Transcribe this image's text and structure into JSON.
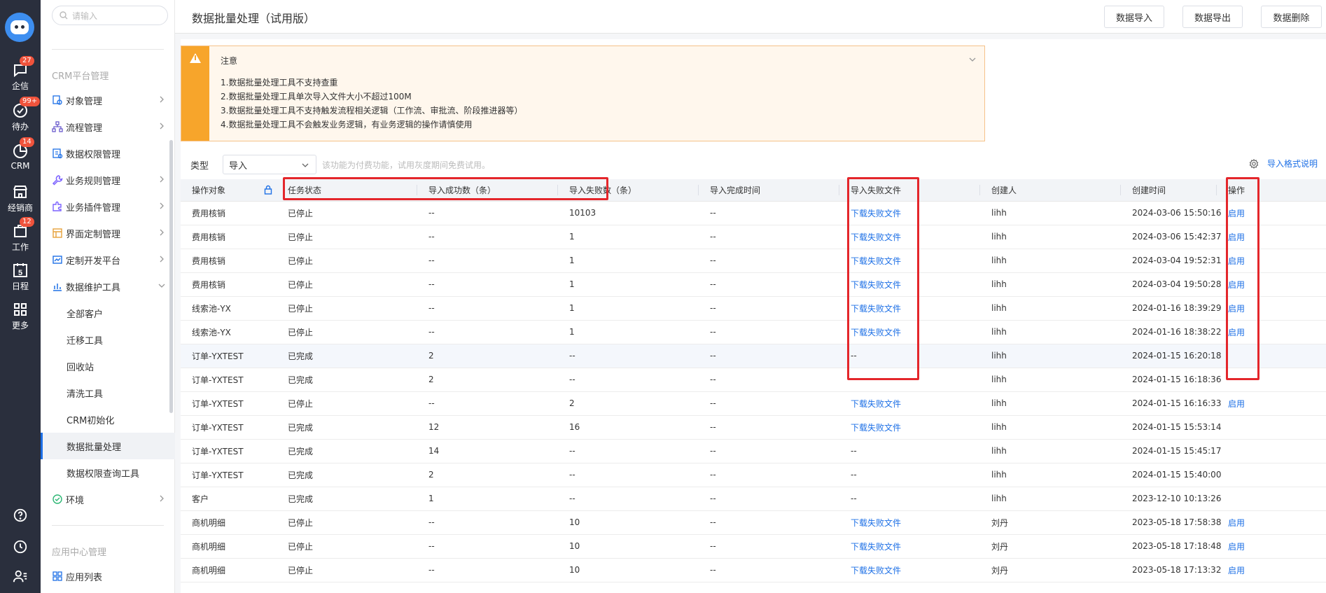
{
  "rail": {
    "items": [
      {
        "label": "企信",
        "badge": "27"
      },
      {
        "label": "待办",
        "badge": "99+"
      },
      {
        "label": "CRM",
        "badge": "14"
      },
      {
        "label": "经销商",
        "badge": ""
      },
      {
        "label": "工作",
        "badge": "12"
      },
      {
        "label": "日程",
        "badge": ""
      },
      {
        "label": "更多",
        "badge": ""
      }
    ],
    "calendar_day": "5"
  },
  "sidebar": {
    "search_placeholder": "请输入",
    "group1": "CRM平台管理",
    "items": [
      {
        "label": "对象管理"
      },
      {
        "label": "流程管理"
      },
      {
        "label": "数据权限管理"
      },
      {
        "label": "业务规则管理"
      },
      {
        "label": "业务插件管理"
      },
      {
        "label": "界面定制管理"
      },
      {
        "label": "定制开发平台"
      },
      {
        "label": "数据维护工具"
      }
    ],
    "sub_items": [
      {
        "label": "全部客户"
      },
      {
        "label": "迁移工具"
      },
      {
        "label": "回收站"
      },
      {
        "label": "清洗工具"
      },
      {
        "label": "CRM初始化"
      },
      {
        "label": "数据批量处理"
      },
      {
        "label": "数据权限查询工具"
      }
    ],
    "env_label": "环境",
    "group2": "应用中心管理",
    "app_list_label": "应用列表"
  },
  "header": {
    "title": "数据批量处理（试用版）",
    "import_btn": "数据导入",
    "export_btn": "数据导出",
    "delete_btn": "数据删除"
  },
  "notice": {
    "title": "注意",
    "lines": [
      "1.数据批量处理工具不支持查重",
      "2.数据批量处理工具单次导入文件大小不超过100M",
      "3.数据批量处理工具不支持触发流程相关逻辑（工作流、审批流、阶段推进器等）",
      "4.数据批量处理工具不会触发业务逻辑，有业务逻辑的操作请慎使用"
    ]
  },
  "filter": {
    "type_label": "类型",
    "type_value": "导入",
    "hint": "该功能为付费功能，试用灰度期间免费试用。",
    "format_link": "导入格式说明"
  },
  "table": {
    "headers": [
      "操作对象",
      "任务状态",
      "导入成功数（条）",
      "导入失败数（条）",
      "导入完成时间",
      "导入失败文件",
      "创建人",
      "创建时间",
      "操作"
    ],
    "rows": [
      [
        "费用核销",
        "已停止",
        "--",
        "10103",
        "--",
        "下载失败文件",
        "lihh",
        "2024-03-06 15:50:16",
        "启用"
      ],
      [
        "费用核销",
        "已停止",
        "--",
        "1",
        "--",
        "下载失败文件",
        "lihh",
        "2024-03-06 15:42:37",
        "启用"
      ],
      [
        "费用核销",
        "已停止",
        "--",
        "1",
        "--",
        "下载失败文件",
        "lihh",
        "2024-03-04 19:52:31",
        "启用"
      ],
      [
        "费用核销",
        "已停止",
        "--",
        "1",
        "--",
        "下载失败文件",
        "lihh",
        "2024-03-04 19:50:28",
        "启用"
      ],
      [
        "线索池-YX",
        "已停止",
        "--",
        "1",
        "--",
        "下载失败文件",
        "lihh",
        "2024-01-16 18:39:29",
        "启用"
      ],
      [
        "线索池-YX",
        "已停止",
        "--",
        "1",
        "--",
        "下载失败文件",
        "lihh",
        "2024-01-16 18:38:22",
        "启用"
      ],
      [
        "订单-YXTEST",
        "已完成",
        "2",
        "--",
        "--",
        "--",
        "lihh",
        "2024-01-15 16:20:18",
        ""
      ],
      [
        "订单-YXTEST",
        "已完成",
        "2",
        "--",
        "--",
        "--",
        "lihh",
        "2024-01-15 16:18:36",
        ""
      ],
      [
        "订单-YXTEST",
        "已停止",
        "--",
        "2",
        "--",
        "下载失败文件",
        "lihh",
        "2024-01-15 16:16:33",
        "启用"
      ],
      [
        "订单-YXTEST",
        "已完成",
        "12",
        "16",
        "--",
        "下载失败文件",
        "lihh",
        "2024-01-15 15:53:14",
        ""
      ],
      [
        "订单-YXTEST",
        "已完成",
        "14",
        "--",
        "--",
        "--",
        "lihh",
        "2024-01-15 15:45:17",
        ""
      ],
      [
        "订单-YXTEST",
        "已完成",
        "2",
        "--",
        "--",
        "--",
        "lihh",
        "2024-01-15 15:40:00",
        ""
      ],
      [
        "客户",
        "已完成",
        "1",
        "--",
        "--",
        "--",
        "lihh",
        "2023-12-10 10:13:26",
        ""
      ],
      [
        "商机明细",
        "已停止",
        "--",
        "10",
        "--",
        "下载失败文件",
        "刘丹",
        "2023-05-18 17:58:38",
        "启用"
      ],
      [
        "商机明细",
        "已停止",
        "--",
        "10",
        "--",
        "下载失败文件",
        "刘丹",
        "2023-05-18 17:18:48",
        "启用"
      ],
      [
        "商机明细",
        "已停止",
        "--",
        "10",
        "--",
        "下载失败文件",
        "刘丹",
        "2023-05-18 17:13:32",
        "启用"
      ]
    ]
  },
  "colors": {
    "accent": "#1e70e6",
    "rail_bg": "#2a2f3d",
    "warning": "#f7a52b",
    "annotation": "#e4262b"
  }
}
